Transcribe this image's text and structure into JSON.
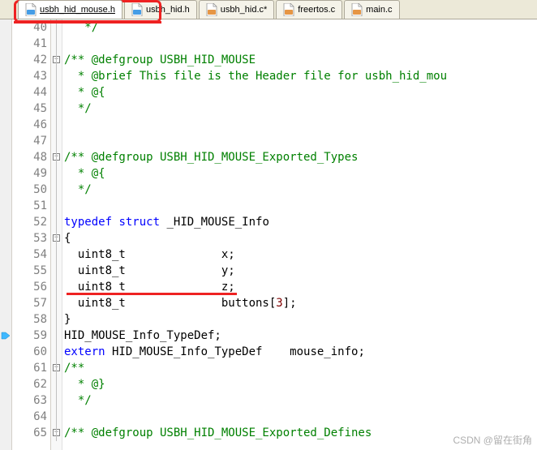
{
  "tabs": [
    {
      "label": "usbh_hid_mouse.h",
      "active": true,
      "icon_type": "h"
    },
    {
      "label": "usbh_hid.h",
      "active": false,
      "icon_type": "h"
    },
    {
      "label": "usbh_hid.c*",
      "active": false,
      "icon_type": "c"
    },
    {
      "label": "freertos.c",
      "active": false,
      "icon_type": "c"
    },
    {
      "label": "main.c",
      "active": false,
      "icon_type": "c"
    }
  ],
  "code": {
    "first_line": 40,
    "lines": [
      {
        "n": 40,
        "fold": null,
        "segs": [
          {
            "cls": "comment",
            "t": "   */"
          }
        ]
      },
      {
        "n": 41,
        "fold": null,
        "segs": []
      },
      {
        "n": 42,
        "fold": "open",
        "segs": [
          {
            "cls": "comment",
            "t": "/** @defgroup USBH_HID_MOUSE"
          }
        ]
      },
      {
        "n": 43,
        "fold": null,
        "segs": [
          {
            "cls": "comment",
            "t": "  * @brief This file is the Header file for usbh_hid_mou"
          }
        ]
      },
      {
        "n": 44,
        "fold": null,
        "segs": [
          {
            "cls": "comment",
            "t": "  * @{"
          }
        ]
      },
      {
        "n": 45,
        "fold": null,
        "segs": [
          {
            "cls": "comment",
            "t": "  */"
          }
        ]
      },
      {
        "n": 46,
        "fold": null,
        "segs": []
      },
      {
        "n": 47,
        "fold": null,
        "segs": []
      },
      {
        "n": 48,
        "fold": "open",
        "segs": [
          {
            "cls": "comment",
            "t": "/** @defgroup USBH_HID_MOUSE_Exported_Types"
          }
        ]
      },
      {
        "n": 49,
        "fold": null,
        "segs": [
          {
            "cls": "comment",
            "t": "  * @{"
          }
        ]
      },
      {
        "n": 50,
        "fold": null,
        "segs": [
          {
            "cls": "comment",
            "t": "  */"
          }
        ]
      },
      {
        "n": 51,
        "fold": null,
        "segs": []
      },
      {
        "n": 52,
        "fold": null,
        "segs": [
          {
            "cls": "kw",
            "t": "typedef"
          },
          {
            "cls": "ident",
            "t": " "
          },
          {
            "cls": "kw",
            "t": "struct"
          },
          {
            "cls": "ident",
            "t": " _HID_MOUSE_Info"
          }
        ]
      },
      {
        "n": 53,
        "fold": "open",
        "segs": [
          {
            "cls": "ident",
            "t": "{"
          }
        ]
      },
      {
        "n": 54,
        "fold": null,
        "segs": [
          {
            "cls": "ident",
            "t": "  uint8_t              x;"
          }
        ]
      },
      {
        "n": 55,
        "fold": null,
        "segs": [
          {
            "cls": "ident",
            "t": "  uint8_t              y;"
          }
        ]
      },
      {
        "n": 56,
        "fold": null,
        "segs": [
          {
            "cls": "ident",
            "t": "  uint8_t              z;"
          }
        ]
      },
      {
        "n": 57,
        "fold": null,
        "segs": [
          {
            "cls": "ident",
            "t": "  uint8_t              buttons["
          },
          {
            "cls": "num",
            "t": "3"
          },
          {
            "cls": "ident",
            "t": "];"
          }
        ]
      },
      {
        "n": 58,
        "fold": null,
        "segs": [
          {
            "cls": "ident",
            "t": "}"
          }
        ]
      },
      {
        "n": 59,
        "fold": null,
        "segs": [
          {
            "cls": "ident",
            "t": "HID_MOUSE_Info_TypeDef;"
          }
        ]
      },
      {
        "n": 60,
        "fold": null,
        "segs": [
          {
            "cls": "kw",
            "t": "extern"
          },
          {
            "cls": "ident",
            "t": " HID_MOUSE_Info_TypeDef    mouse_info;"
          }
        ]
      },
      {
        "n": 61,
        "fold": "open",
        "segs": [
          {
            "cls": "comment",
            "t": "/**"
          }
        ]
      },
      {
        "n": 62,
        "fold": null,
        "segs": [
          {
            "cls": "comment",
            "t": "  * @}"
          }
        ]
      },
      {
        "n": 63,
        "fold": null,
        "segs": [
          {
            "cls": "comment",
            "t": "  */"
          }
        ]
      },
      {
        "n": 64,
        "fold": null,
        "segs": []
      },
      {
        "n": 65,
        "fold": "open",
        "segs": [
          {
            "cls": "comment",
            "t": "/** @defgroup USBH_HID_MOUSE_Exported_Defines"
          }
        ]
      }
    ],
    "bookmark_line": 59
  },
  "icons": {
    "h": {
      "fg": "#459de6",
      "letter": "h"
    },
    "c": {
      "fg": "#e69645",
      "letter": "c"
    }
  },
  "watermark": "CSDN @留在街角",
  "annotation_line2_row": 17
}
